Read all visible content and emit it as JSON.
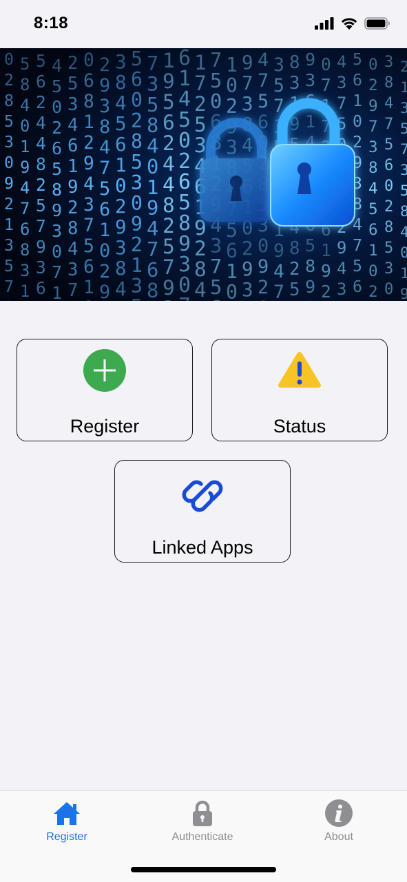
{
  "status_bar": {
    "time": "8:18"
  },
  "hero": {
    "icon": "padlock-digital-rain-image",
    "digits": "0285309213573584019476831956244825793614502658930717253461928437506812943756102938475610297384561029384756"
  },
  "tiles": {
    "register": {
      "label": "Register",
      "icon": "plus-circle-icon",
      "color": "#3daa4f"
    },
    "status": {
      "label": "Status",
      "icon": "warning-icon",
      "color": "#f7c325"
    },
    "linked_apps": {
      "label": "Linked Apps",
      "icon": "link-icon",
      "color": "#1a4bd6"
    }
  },
  "tab_bar": {
    "active": "register",
    "accent": "#1a73e8",
    "items": [
      {
        "label": "Register",
        "icon": "home-icon"
      },
      {
        "label": "Authenticate",
        "icon": "lock-icon"
      },
      {
        "label": "About",
        "icon": "info-icon"
      }
    ]
  }
}
